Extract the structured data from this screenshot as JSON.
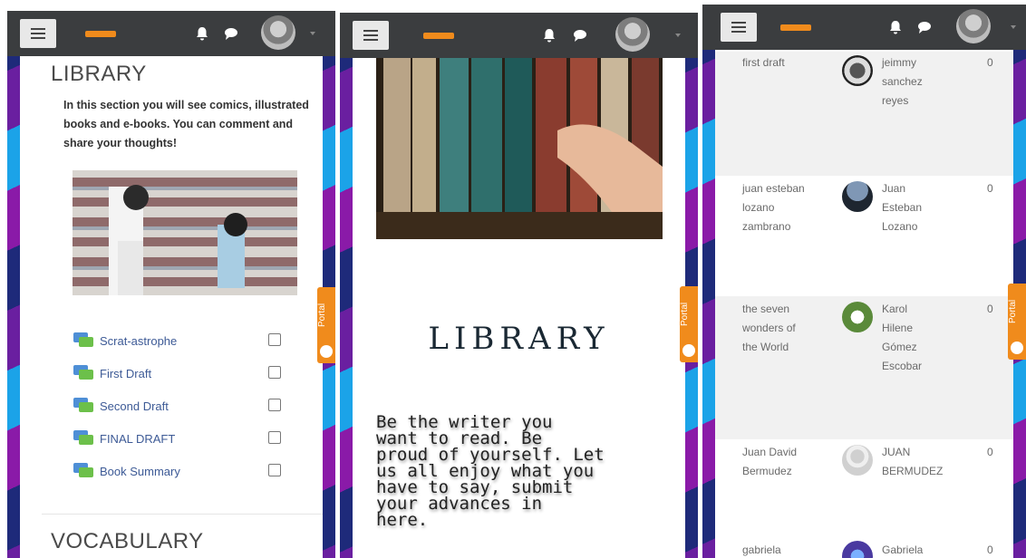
{
  "panel_left": {
    "library_title": "LIBRARY",
    "library_intro": "In this section you will see comics, illustrated books and e-books. You can comment and share your thoughts!",
    "activities": [
      {
        "label": "Scrat-astrophe",
        "icon": "forum-icon"
      },
      {
        "label": "First Draft",
        "icon": "forum-icon"
      },
      {
        "label": "Second Draft",
        "icon": "forum-icon"
      },
      {
        "label": "FINAL DRAFT",
        "icon": "forum-icon"
      },
      {
        "label": "Book Summary",
        "icon": "forum-icon"
      }
    ],
    "next_section_title": "VOCABULARY",
    "portal_label": "Portal"
  },
  "panel_middle": {
    "title": "LIBRARY",
    "quote": "Be the writer you\nwant to read. Be\nproud of yourself. Let\nus all enjoy what you\nhave to say, submit\nyour advances in\nhere.",
    "portal_label": "Portal"
  },
  "panel_right": {
    "rows": [
      {
        "title": "first draft",
        "author": "jeimmy\nsanchez\nreyes",
        "count": "0"
      },
      {
        "title": "juan esteban\nlozano\nzambrano",
        "author": "Juan\nEsteban\nLozano",
        "count": "0"
      },
      {
        "title": "the seven\nwonders of\nthe World",
        "author": "Karol\nHilene\nGómez\nEscobar",
        "count": "0"
      },
      {
        "title": "Juan David\nBermudez",
        "author": "JUAN\nBERMUDEZ",
        "count": "0"
      },
      {
        "title": "gabriela",
        "author": "Gabriela",
        "count": "0"
      }
    ],
    "portal_label": "Portal"
  },
  "topbar": {
    "menu_icon": "hamburger-icon",
    "notification_icon": "bell-icon",
    "message_icon": "chat-icon",
    "accent_color": "#f08b1c",
    "bar_color": "#3b3d3f"
  }
}
